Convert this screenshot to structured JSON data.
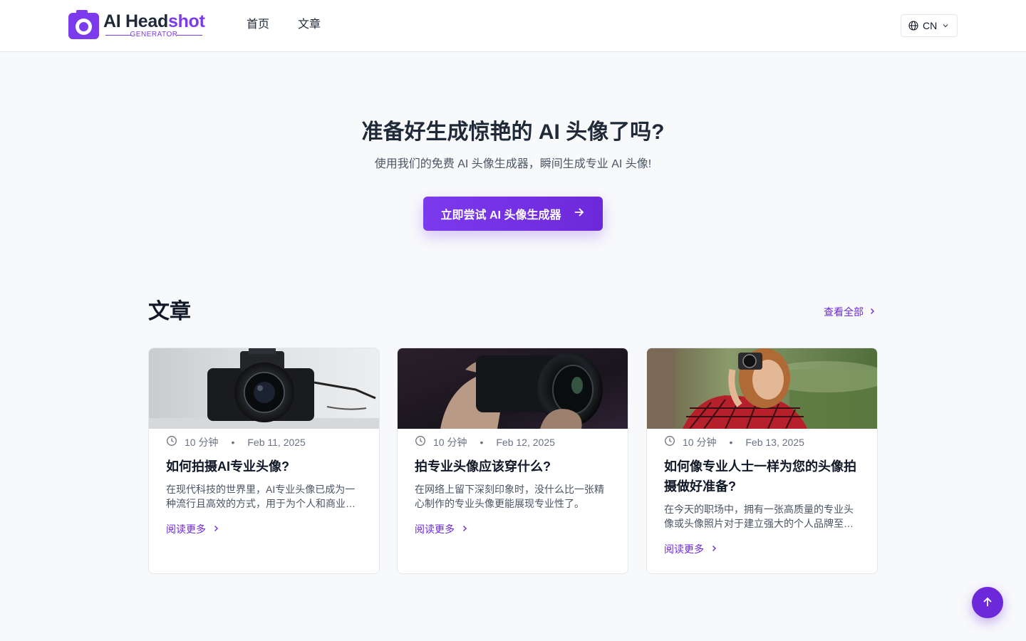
{
  "header": {
    "logo": {
      "name_main": "AI Head",
      "name_accent": "shot",
      "subtitle": "GENERATOR"
    },
    "nav": [
      {
        "label": "首页"
      },
      {
        "label": "文章"
      }
    ],
    "language": {
      "value": "CN",
      "icon": "globe-icon"
    }
  },
  "hero": {
    "title": "准备好生成惊艳的 AI 头像了吗?",
    "subtitle": "使用我们的免费 AI 头像生成器，瞬间生成专业 AI 头像!",
    "cta_label": "立即尝试 AI 头像生成器",
    "cta_icon": "arrow-right-icon"
  },
  "articles": {
    "heading": "文章",
    "view_all_label": "查看全部",
    "read_more_label": "阅读更多",
    "items": [
      {
        "image": "camera-on-table",
        "read_time": "10 分钟",
        "date": "Feb 11, 2025",
        "title": "如何拍摄AI专业头像?",
        "excerpt": "在现代科技的世界里，AI专业头像已成为一种流行且高效的方式，用于为个人和商业用途创建高质量的头像。"
      },
      {
        "image": "hands-holding-lens",
        "read_time": "10 分钟",
        "date": "Feb 12, 2025",
        "title": "拍专业头像应该穿什么?",
        "excerpt": "在网络上留下深刻印象时，没什么比一张精心制作的专业头像更能展现专业性了。"
      },
      {
        "image": "woman-with-camera",
        "read_time": "10 分钟",
        "date": "Feb 13, 2025",
        "title": "如何像专业人士一样为您的头像拍摄做好准备?",
        "excerpt": "在今天的职场中，拥有一张高质量的专业头像或头像照片对于建立强大的个人品牌至关重要。"
      }
    ]
  },
  "back_to_top": {
    "icon": "arrow-up-icon"
  },
  "colors": {
    "accent": "#7c3aed",
    "accent_dark": "#6d28d9",
    "text": "#1f2937",
    "background": "#f8f9fb"
  }
}
